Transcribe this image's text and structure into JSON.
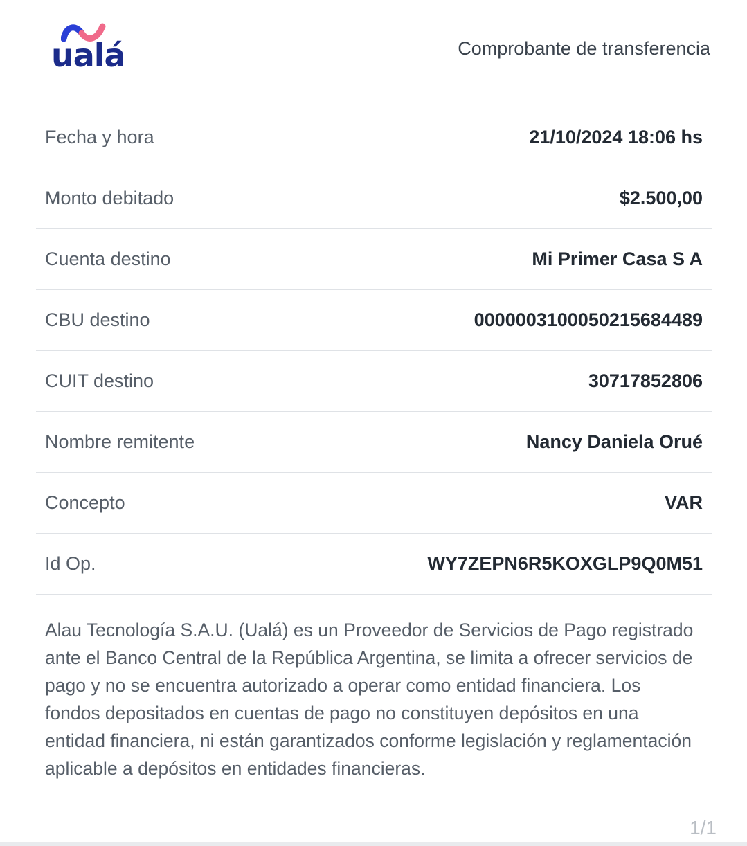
{
  "brand": {
    "name": "ualá",
    "colors": {
      "primary": "#1b2b8a",
      "accent_blue": "#2a3fd6",
      "accent_pink": "#f06a8a"
    }
  },
  "header": {
    "title": "Comprobante de transferencia"
  },
  "rows": [
    {
      "label": "Fecha y hora",
      "value": "21/10/2024 18:06 hs"
    },
    {
      "label": "Monto debitado",
      "value": "$2.500,00"
    },
    {
      "label": "Cuenta destino",
      "value": "Mi Primer Casa S A"
    },
    {
      "label": "CBU destino",
      "value": "0000003100050215684489"
    },
    {
      "label": "CUIT destino",
      "value": "30717852806"
    },
    {
      "label": "Nombre remitente",
      "value": "Nancy Daniela Orué"
    },
    {
      "label": "Concepto",
      "value": "VAR"
    },
    {
      "label": "Id Op.",
      "value": "WY7ZEPN6R5KOXGLP9Q0M51"
    }
  ],
  "disclaimer": "Alau Tecnología S.A.U. (Ualá) es un Proveedor de Servicios de Pago registrado ante el Banco Central de la República Argentina, se limita a ofrecer servicios de pago y no se encuentra autorizado a operar como entidad financiera. Los fondos depositados en cuentas de pago no constituyen depósitos en una entidad financiera, ni están garantizados conforme legislación y reglamentación aplicable a depósitos en entidades financieras.",
  "page_indicator": "1/1"
}
